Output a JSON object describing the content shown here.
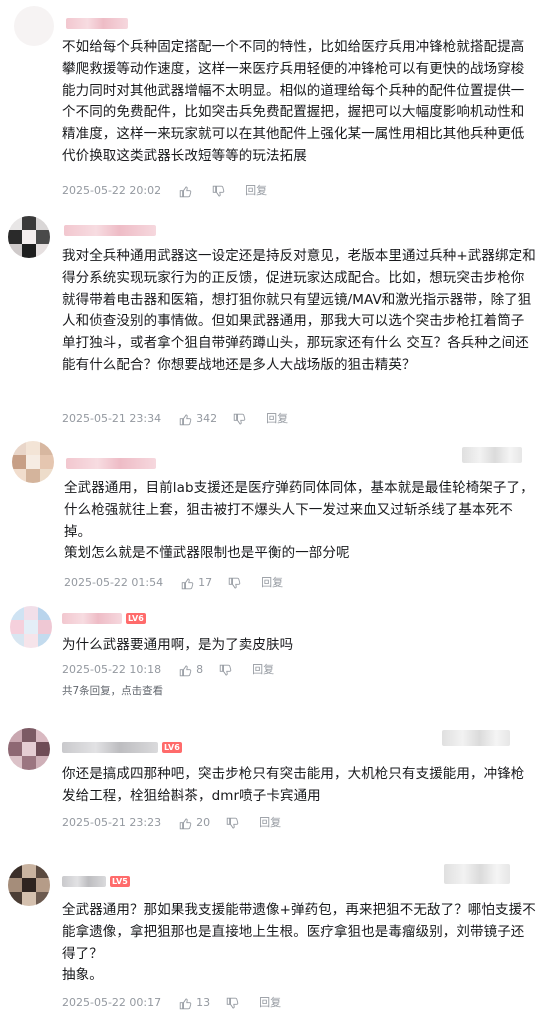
{
  "comments": [
    {
      "id": "c1",
      "level": "",
      "text": [
        "不如给每个兵种固定搭配一个不同的特性，比如给医疗兵用冲锋枪就搭配提高攀爬救援等动作速度，这样一来医疗兵用轻便的冲锋枪可以有更快的战场穿梭能力同时对其他武器增幅不太明显。相似的道理给每个兵种的配件位置提供一个不同的免费配件，比如突击兵免费配置握把，握把可以大幅度影响机动性和精准度，这样一来玩家就可以在其他配件上强化某一属性用相比其他兵种更低代价换取这类武器长改短等等的玩法拓展"
      ],
      "time": "2025-05-22 20:02",
      "likes": "",
      "reply_label": "回复"
    },
    {
      "id": "c2",
      "level": "",
      "text": [
        "我对全兵种通用武器这一设定还是持反对意见，老版本里通过兵种+武器绑定和得分系统实现玩家行为的正反馈，促进玩家达成配合。比如，想玩突击步枪你就得带着电击器和医箱，想打狙你就只有望远镜/MAV和激光指示器带，除了狙人和侦查没别的事情做。但如果武器通用，那我大可以选个突击步枪扛着筒子单打独斗，或者拿个狙自带弹药蹲山头，那玩家还有什么 交互？各兵种之间还能有什么配合？你想要战地还是多人大战场版的狙击精英？"
      ],
      "time": "2025-05-21 23:34",
      "likes": "342",
      "reply_label": "回复"
    },
    {
      "id": "c3",
      "level": "",
      "text": [
        "全武器通用，目前lab支援还是医疗弹药同体同体，基本就是最佳轮椅架子了，什么枪强就往上套，狙击被打不爆头人下一发过来血又过斩杀线了基本死不掉。",
        "策划怎么就是不懂武器限制也是平衡的一部分呢"
      ],
      "time": "2025-05-22 01:54",
      "likes": "17",
      "reply_label": "回复"
    },
    {
      "id": "c4",
      "level": "LV6",
      "text": [
        "为什么武器要通用啊，是为了卖皮肤吗"
      ],
      "time": "2025-05-22 10:18",
      "likes": "8",
      "reply_label": "回复",
      "replies_count_label": "共7条回复，点击查看"
    },
    {
      "id": "c5",
      "level": "LV6",
      "text": [
        "你还是搞成四那种吧，突击步枪只有突击能用，大机枪只有支援能用，冲锋枪发给工程，栓狙给斟茶，dmr喷子卡宾通用"
      ],
      "time": "2025-05-21 23:23",
      "likes": "20",
      "reply_label": "回复"
    },
    {
      "id": "c6",
      "level": "LV5",
      "text": [
        "全武器通用？那如果我支援能带遗像+弹药包，再来把狙不无敌了？哪怕支援不能拿遗像，拿把狙那也是直接地上生根。医疗拿狙也是毒瘤级别，刘带镜子还得了？",
        "抽象。"
      ],
      "time": "2025-05-22 00:17",
      "likes": "13",
      "reply_label": "回复"
    }
  ],
  "colors": {
    "text": "#18191c",
    "meta": "#9499a0",
    "level_badge": "#ff6b6b"
  },
  "icons": {
    "like": "thumb-up-icon",
    "dislike": "thumb-down-icon"
  }
}
